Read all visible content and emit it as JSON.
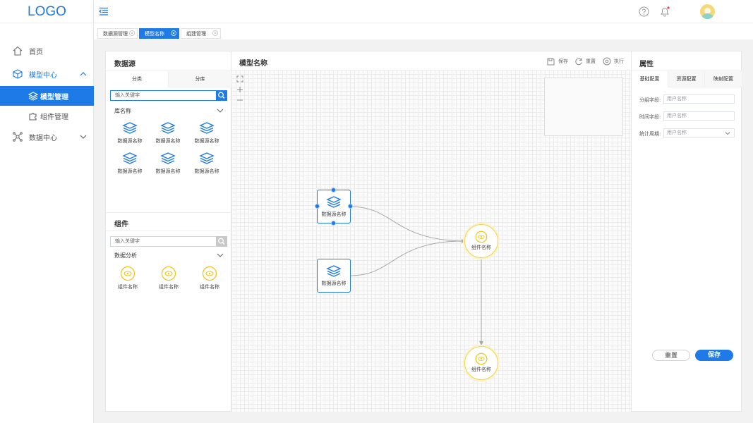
{
  "app": {
    "logo": "LOGO"
  },
  "sidebar": {
    "items": [
      {
        "label": "首页",
        "icon": "home-icon"
      },
      {
        "label": "模型中心",
        "icon": "cube-icon"
      },
      {
        "label": "模型管理",
        "icon": "layers-icon"
      },
      {
        "label": "组件管理",
        "icon": "puzzle-icon"
      },
      {
        "label": "数据中心",
        "icon": "network-icon"
      }
    ]
  },
  "tabs": [
    {
      "label": "数据源管理"
    },
    {
      "label": "模型名称"
    },
    {
      "label": "组建管理"
    }
  ],
  "datasource_panel": {
    "title": "数据源",
    "tabs": [
      "分类",
      "分库"
    ],
    "search_placeholder": "输入关键字",
    "group_label": "库名称",
    "items": [
      "数据源名称",
      "数据源名称",
      "数据源名称",
      "数据源名称",
      "数据源名称",
      "数据源名称"
    ]
  },
  "component_panel": {
    "title": "组件",
    "search_placeholder": "输入关键字",
    "group_label": "数据分析",
    "items": [
      "组件名称",
      "组件名称",
      "组件名称"
    ]
  },
  "canvas": {
    "title": "模型名称",
    "actions": {
      "save": "保存",
      "reset": "重置",
      "run": "执行"
    },
    "nodes": {
      "ds1": "数据源名称",
      "ds2": "数据源名称",
      "comp1": "组件名称",
      "comp2": "组件名称"
    }
  },
  "properties": {
    "title": "属性",
    "tabs": [
      "基础配置",
      "资源配置",
      "映射配置"
    ],
    "fields": [
      {
        "label": "分组字段:",
        "placeholder": "用户名称"
      },
      {
        "label": "时间字段:",
        "placeholder": "用户名称"
      },
      {
        "label": "统计周期:",
        "placeholder": "用户名称"
      }
    ],
    "reset_label": "重置",
    "save_label": "保存"
  },
  "colors": {
    "accent": "#1e7ae6",
    "component": "#f0c419"
  }
}
